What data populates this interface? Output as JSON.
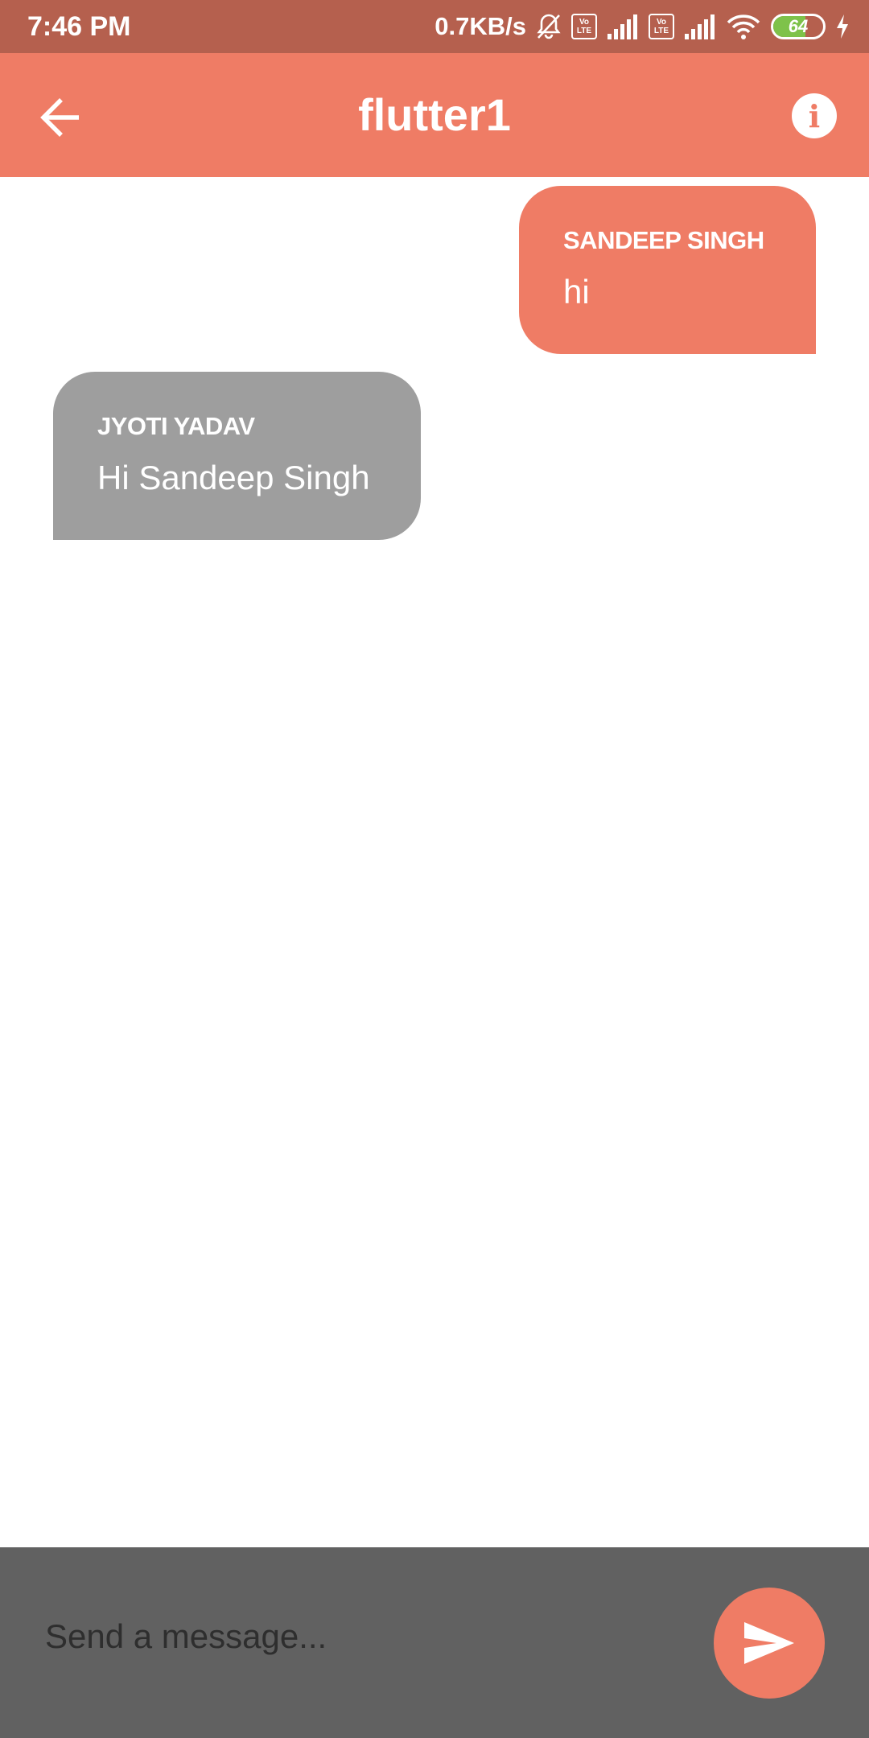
{
  "status_bar": {
    "time": "7:46 PM",
    "net_speed": "0.7KB/s",
    "volte_line1": "Vo",
    "volte_line2": "LTE",
    "battery_percent": "64",
    "icons": [
      "mute-bell-icon",
      "volte-icon",
      "signal-icon",
      "volte-icon",
      "signal-icon",
      "wifi-icon",
      "battery-icon",
      "charging-icon"
    ]
  },
  "app_bar": {
    "title": "flutter1",
    "back_icon": "arrow-left-icon",
    "info_icon": "info-icon"
  },
  "messages": [
    {
      "sender": "SANDEEP SINGH",
      "text": "hi",
      "direction": "outgoing"
    },
    {
      "sender": "JYOTI YADAV",
      "text": "Hi Sandeep Singh",
      "direction": "incoming"
    }
  ],
  "composer": {
    "placeholder": "Send a message...",
    "send_icon": "send-icon"
  },
  "colors": {
    "accent": "#ef7c65",
    "status_bar": "#b5604e",
    "incoming_bubble": "#9e9e9e",
    "composer_bg": "#616161"
  }
}
